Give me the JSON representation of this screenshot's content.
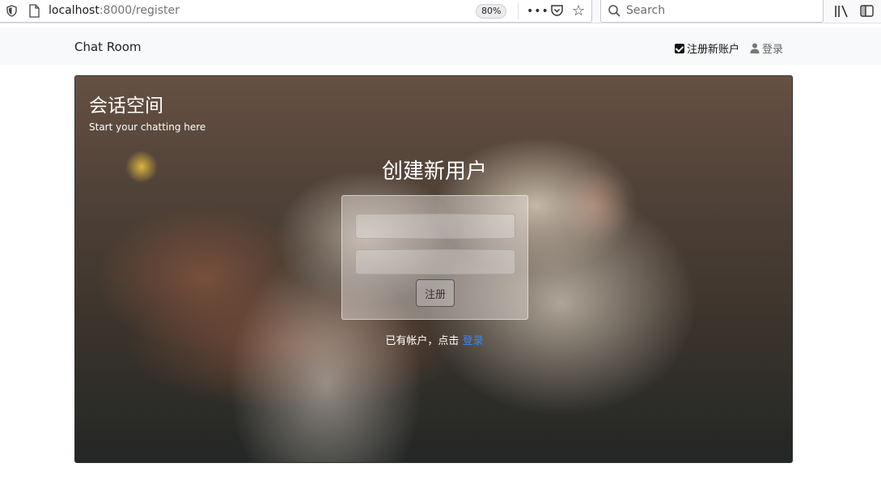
{
  "browser": {
    "url_host": "localhost",
    "url_path": ":8000/register",
    "zoom": "80%",
    "search_placeholder": "Search"
  },
  "navbar": {
    "brand": "Chat Room",
    "register_label": "注册新账户",
    "login_label": "登录"
  },
  "hero": {
    "title": "会话空间",
    "subtitle": "Start your chatting here",
    "form_title": "创建新用户",
    "field1_value": "",
    "field2_value": "",
    "submit_label": "注册",
    "login_hint": "已有帐户，点击",
    "login_link": "登录"
  },
  "colors": {
    "link": "#2f8bff",
    "navbar_bg": "#f8f9fa"
  }
}
